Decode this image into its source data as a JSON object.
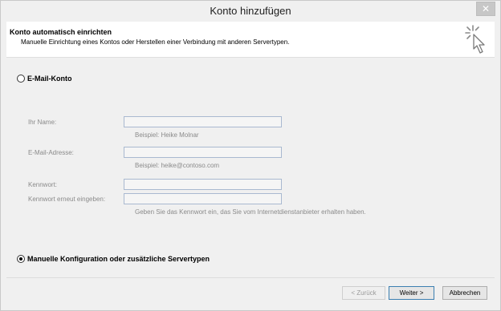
{
  "window": {
    "title": "Konto hinzufügen",
    "close_label": "✕"
  },
  "header": {
    "title": "Konto automatisch einrichten",
    "subtitle": "Manuelle Einrichtung eines Kontos oder Herstellen einer Verbindung mit anderen Servertypen."
  },
  "options": {
    "email_account": {
      "label": "E-Mail-Konto",
      "selected": false
    },
    "manual": {
      "label": "Manuelle Konfiguration oder zusätzliche Servertypen",
      "selected": true
    }
  },
  "form": {
    "name_label": "Ihr Name:",
    "name_value": "",
    "name_hint": "Beispiel: Heike Molnar",
    "email_label": "E-Mail-Adresse:",
    "email_value": "",
    "email_hint": "Beispiel: heike@contoso.com",
    "password_label": "Kennwort:",
    "password_confirm_label": "Kennwort erneut eingeben:",
    "password_hint": "Geben Sie das Kennwort ein, das Sie vom Internetdienstanbieter erhalten haben."
  },
  "buttons": {
    "back": "< Zurück",
    "next": "Weiter >",
    "cancel": "Abbrechen"
  }
}
